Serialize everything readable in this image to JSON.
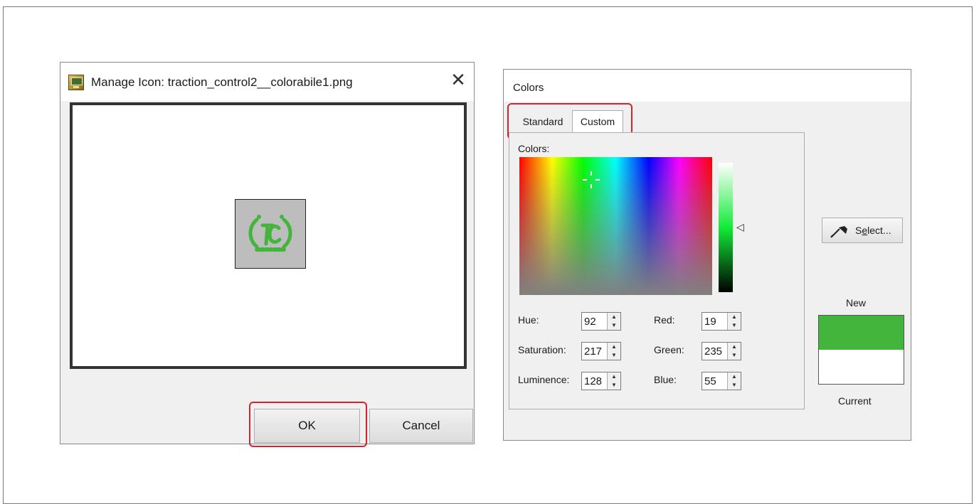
{
  "manage_icon_dialog": {
    "title": "Manage Icon: traction_control2__colorabile1.png",
    "close_glyph": "✕",
    "ok_label": "OK",
    "cancel_label": "Cancel",
    "icon_color": "#43b53c",
    "app_icon": "app-icon",
    "preview_icon": "traction-control-icon"
  },
  "colors_dialog": {
    "title": "Colors",
    "tabs": [
      {
        "label": "Standard",
        "selected": false
      },
      {
        "label": "Custom",
        "selected": true
      }
    ],
    "colors_label": "Colors:",
    "luminance_arrow": "◁",
    "fields": {
      "hue": {
        "label": "Hue:",
        "value": "92"
      },
      "saturation": {
        "label": "Saturation:",
        "value": "217"
      },
      "luminence": {
        "label": "Luminence:",
        "value": "128"
      },
      "red": {
        "label": "Red:",
        "value": "19"
      },
      "green": {
        "label": "Green:",
        "value": "235"
      },
      "blue": {
        "label": "Blue:",
        "value": "55"
      }
    },
    "select_button": {
      "label_prefix": "S",
      "label_mnemonic": "e",
      "label_suffix": "lect...",
      "icon": "eyedropper-icon"
    },
    "new_label": "New",
    "current_label": "Current",
    "new_color": "#43b53c",
    "current_color": "#ffffff"
  },
  "highlight_color": "#d0252f"
}
